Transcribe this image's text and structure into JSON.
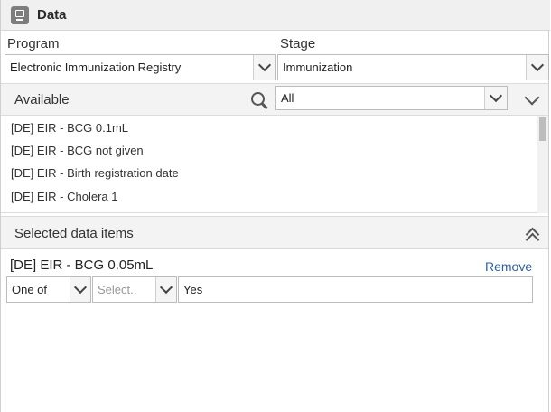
{
  "header": {
    "title": "Data",
    "icon": "monitor-icon"
  },
  "program": {
    "label": "Program",
    "value": "Electronic Immunization Registry"
  },
  "stage": {
    "label": "Stage",
    "value": "Immunization"
  },
  "available": {
    "title": "Available",
    "filter_value": "All",
    "items": [
      "[DE] EIR - BCG 0.1mL",
      "[DE] EIR - BCG not given",
      "[DE] EIR - Birth registration date",
      "[DE] EIR - Cholera 1"
    ]
  },
  "selected": {
    "title": "Selected data items",
    "items": [
      {
        "name": "[DE] EIR - BCG 0.05mL",
        "remove_label": "Remove",
        "operator": "One of",
        "select_placeholder": "Select..",
        "value": "Yes"
      }
    ]
  },
  "colors": {
    "link": "#2f5f9e",
    "header_bg": "#f0f0f0"
  }
}
